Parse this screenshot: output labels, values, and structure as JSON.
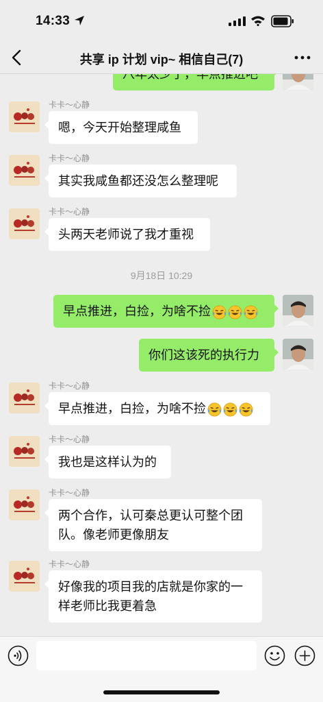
{
  "status": {
    "time": "14:33"
  },
  "nav": {
    "title": "共享 ip 计划 vip~ 相信自己(7)"
  },
  "messages": [
    {
      "text": "八年太少了，早点推进吧"
    },
    {
      "sender": "卡卡～心静",
      "text": "嗯，今天开始整理咸鱼"
    },
    {
      "sender": "卡卡～心静",
      "text": "其实我咸鱼都还没怎么整理呢"
    },
    {
      "sender": "卡卡～心静",
      "text": "头两天老师说了我才重视"
    },
    {
      "text": "早点推进，白捡，为啥不捡",
      "emoji": "crying-laughing-emoji ×3"
    },
    {
      "text": "你们这该死的执行力"
    },
    {
      "sender": "卡卡～心静",
      "text": "早点推进，白捡，为啥不捡",
      "emoji": "crying-laughing-emoji ×3"
    },
    {
      "sender": "卡卡～心静",
      "text": "我也是这样认为的"
    },
    {
      "sender": "卡卡～心静",
      "text": "两个合作，认可秦总更认可整个团队。像老师更像朋友"
    },
    {
      "sender": "卡卡～心静",
      "text": "好像我的项目我的店就是你家的一样老师比我更着急"
    }
  ],
  "timestamp": "9月18日 10:29",
  "input": {
    "value": ""
  },
  "colors": {
    "background": "#ededed",
    "bubble_out": "#95ec69",
    "bubble_in": "#ffffff"
  }
}
